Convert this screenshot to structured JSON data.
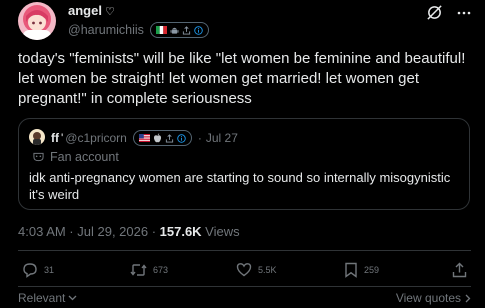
{
  "author": {
    "name": "angel",
    "name_suffix": "♡",
    "handle": "@harumichiis",
    "badge_icons": [
      "italy-flag-icon",
      "android-icon",
      "share-icon",
      "info-icon"
    ]
  },
  "tweet": {
    "text": "today's \"feminists\" will be like \"let women be feminine and beautiful! let women be straight! let women get married! let women get pregnant!\" in complete seriousness"
  },
  "quote": {
    "name": "ff",
    "name_suffix": "'",
    "handle": "@c1pricorn",
    "separator": "·",
    "date": "Jul 27",
    "badge_icons": [
      "usa-flag-icon",
      "apple-icon",
      "share-icon",
      "info-icon"
    ],
    "fan_label": "Fan account",
    "text": "idk anti-pregnancy women are starting to sound so internally misogynistic it's weird"
  },
  "meta": {
    "time_date": "4:03 AM · Jul 29, 2026 · ",
    "views_count": "157.6K",
    "views_label": " Views"
  },
  "actions": {
    "replies": "31",
    "reposts": "673",
    "likes": "5.5K",
    "bookmarks": "259"
  },
  "footer": {
    "relevant": "Relevant",
    "view_quotes": "View quotes"
  },
  "colors": {
    "background": "#000000",
    "text": "#e7e9ea",
    "muted": "#71767b",
    "border": "#2f3336"
  }
}
